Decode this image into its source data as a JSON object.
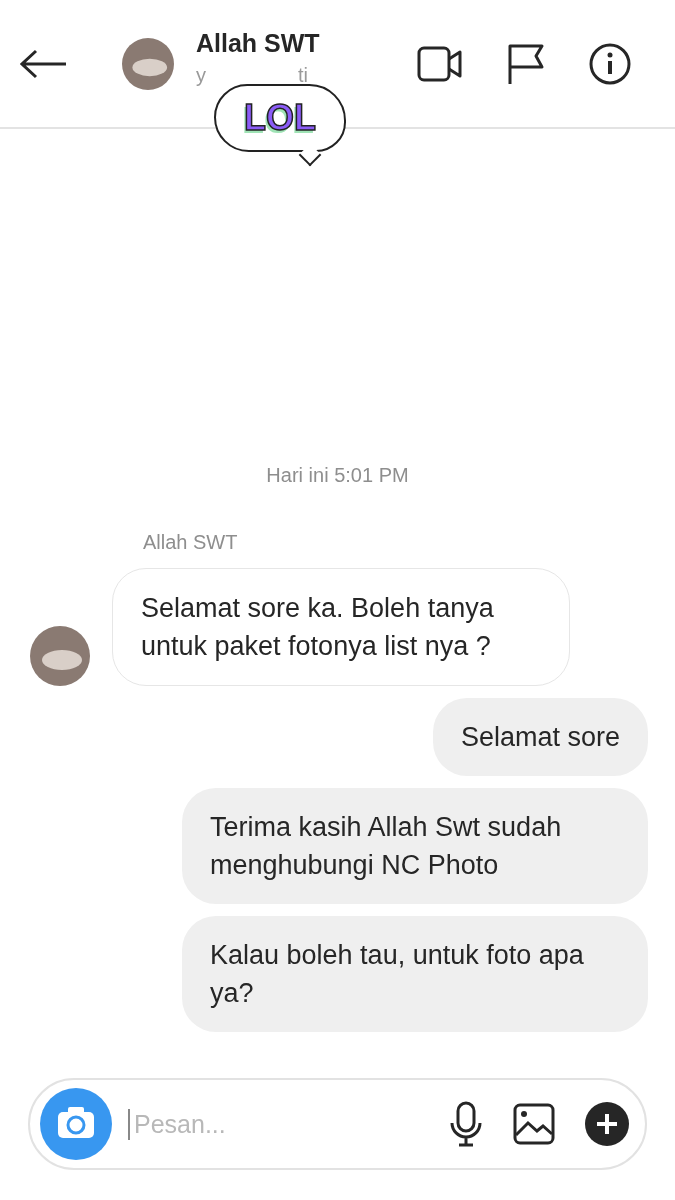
{
  "header": {
    "name": "Allah SWT",
    "subtitle_parts": [
      "y",
      "ti"
    ]
  },
  "sticker": {
    "text": "LOL"
  },
  "timestamp": "Hari ini 5:01 PM",
  "sender_name": "Allah SWT",
  "messages": [
    {
      "kind": "incoming",
      "text": "Selamat sore ka. Boleh tanya untuk paket fotonya list nya ?"
    },
    {
      "kind": "outgoing",
      "text": "Selamat sore"
    },
    {
      "kind": "outgoing",
      "text": "Terima kasih Allah Swt sudah menghubungi NC Photo"
    },
    {
      "kind": "outgoing",
      "text": "Kalau boleh tau, untuk foto apa ya?"
    }
  ],
  "composer": {
    "placeholder": "Pesan..."
  }
}
